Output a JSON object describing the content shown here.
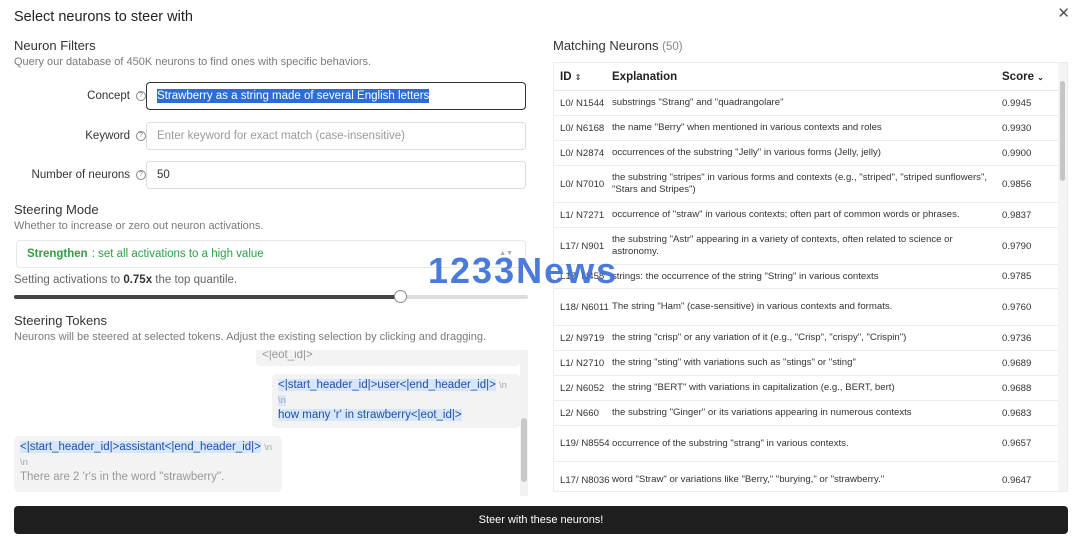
{
  "dialog": {
    "title": "Select neurons to steer with",
    "close_icon": "close-icon"
  },
  "filters": {
    "title": "Neuron Filters",
    "subtitle": "Query our database of 450K neurons to find ones with specific behaviors.",
    "concept_label": "Concept",
    "concept_value": "Strawberry as a string made of several English letters",
    "keyword_label": "Keyword",
    "keyword_placeholder": "Enter keyword for exact match (case-insensitive)",
    "neurons_label": "Number of neurons",
    "neurons_value": "50"
  },
  "mode": {
    "title": "Steering Mode",
    "subtitle": "Whether to increase or zero out neuron activations.",
    "option_bold": "Strengthen",
    "option_rest": ": set all activations to a high value",
    "act_prefix": "Setting activations to ",
    "act_value": "0.75x",
    "act_suffix": " the top quantile.",
    "slider_level": 0.75
  },
  "tokens": {
    "title": "Steering Tokens",
    "subtitle": "Neurons will be steered at selected tokens. Adjust the existing selection by clicking and dragging.",
    "top_fragment": "<|eot_id|>",
    "user_header": "<|start_header_id|>user<|end_header_id|>",
    "nl": "\\n",
    "user_msg": "how many 'r' in strawberry<|eot_id|>",
    "assistant_header": "<|start_header_id|>assistant<|end_header_id|>",
    "assistant_msg": "There are 2 'r's in the word \"strawberry\"."
  },
  "matching": {
    "title": "Matching Neurons",
    "count": "(50)",
    "col_id": "ID",
    "col_explanation": "Explanation",
    "col_score": "Score",
    "rows": [
      {
        "id": "L0/ N1544",
        "exp": "substrings \"Strang\" and \"quadrangolare\"",
        "score": "0.9945"
      },
      {
        "id": "L0/ N6168",
        "exp": "the name \"Berry\" when mentioned in various contexts and roles",
        "score": "0.9930"
      },
      {
        "id": "L0/ N2874",
        "exp": "occurrences of the substring \"Jelly\" in various forms (Jelly, jelly)",
        "score": "0.9900"
      },
      {
        "id": "L0/ N7010",
        "exp": "the substring \"stripes\" in various forms and contexts (e.g., \"striped\", \"striped sunflowers\", \"Stars and Stripes\")",
        "score": "0.9856"
      },
      {
        "id": "L1/ N7271",
        "exp": "occurrence of \"straw\" in various contexts; often part of common words or phrases.",
        "score": "0.9837"
      },
      {
        "id": "L17/ N901",
        "exp": "the substring \"Astr\" appearing in a variety of contexts, often related to science or astronomy.",
        "score": "0.9790"
      },
      {
        "id": "L17/ N458",
        "exp": "strings: the occurrence of the string \"String\" in various contexts",
        "score": "0.9785"
      },
      {
        "id": "L18/ N6011",
        "exp": "The string \"Ham\" (case-sensitive) in various contexts and formats.",
        "score": "0.9760"
      },
      {
        "id": "L2/ N9719",
        "exp": "the string \"crisp\" or any variation of it (e.g., \"Crisp\", \"crispy\", \"Crispin\")",
        "score": "0.9736"
      },
      {
        "id": "L1/ N2710",
        "exp": "the string \"sting\" with variations such as \"stings\" or \"sting\"",
        "score": "0.9689"
      },
      {
        "id": "L2/ N6052",
        "exp": "the string \"BERT\" with variations in capitalization (e.g., BERT, bert)",
        "score": "0.9688"
      },
      {
        "id": "L2/ N660",
        "exp": "the substring \"Ginger\" or its variations appearing in numerous contexts",
        "score": "0.9683"
      },
      {
        "id": "L19/ N8554",
        "exp": "occurrence of the substring \"strang\" in various contexts.",
        "score": "0.9657"
      },
      {
        "id": "L17/ N8036",
        "exp": "word \"Straw\" or variations like \"Berry,\" \"burying,\" or \"strawberry.\"",
        "score": "0.9647"
      }
    ]
  },
  "steer_button": "Steer with these neurons!",
  "watermark": "1233News"
}
